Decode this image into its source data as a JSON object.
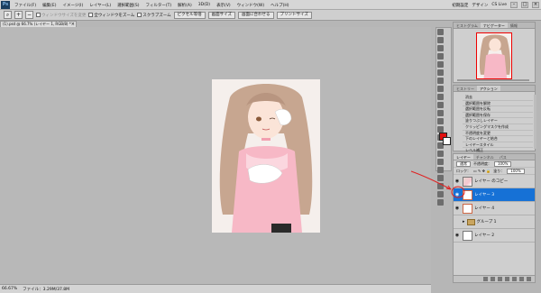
{
  "app": {
    "logo": "Ps"
  },
  "menu": [
    "ファイル(F)",
    "編集(E)",
    "イメージ(I)",
    "レイヤー(L)",
    "選択範囲(S)",
    "フィルター(T)",
    "解析(A)",
    "3D(D)",
    "表示(V)",
    "ウィンドウ(W)",
    "ヘルプ(H)"
  ],
  "workspace": "初期設定",
  "workspace_extra": "デザイン",
  "cslive": "CS Live",
  "options": {
    "chk1": "ウィンドウサイズを変更",
    "chk2": "全ウィンドウをズーム",
    "chk3": "スクラブズーム",
    "btn1": "ピクセル等倍",
    "btn2": "画面サイズ",
    "btn3": "画面に合わせる",
    "btn4": "プリントサイズ"
  },
  "document": {
    "tab": "(1).psd @ 66.7% (レイヤー 1, RGB/8) *"
  },
  "status": {
    "zoom": "66.67%",
    "file": "ファイル：3.29M/37.8M"
  },
  "navigator": {
    "tabs": [
      "ヒストグラム",
      "ナビゲーター",
      "情報"
    ]
  },
  "actions": {
    "tabs": [
      "ヒストリー",
      "アクション"
    ],
    "items": [
      "消去",
      "選択範囲を解除",
      "選択範囲を反転",
      "選択範囲を保存",
      "塗りつぶしレイヤー",
      "クリッピングマスクを作成",
      "不透明度を変更",
      "下のレイヤーと結合",
      "レイヤースタイル",
      "レベル補正",
      "選択範囲を作成",
      "ペースト",
      "結合"
    ]
  },
  "layers": {
    "tabs": [
      "レイヤー",
      "チャンネル",
      "パス"
    ],
    "blend": "通常",
    "opacity_label": "不透明度：",
    "opacity": "100%",
    "lock_label": "ロック：",
    "fill_label": "塗り：",
    "fill": "100%",
    "items": [
      {
        "name": "レイヤー のコピー"
      },
      {
        "name": "レイヤー 3"
      },
      {
        "name": "レイヤー 4"
      },
      {
        "name": "グループ 1"
      },
      {
        "name": "レイヤー 2"
      }
    ]
  },
  "colors": {
    "foreground": "#e21010",
    "background": "#ffffff",
    "selection": "#1671d6",
    "annotation": "#e02020"
  }
}
